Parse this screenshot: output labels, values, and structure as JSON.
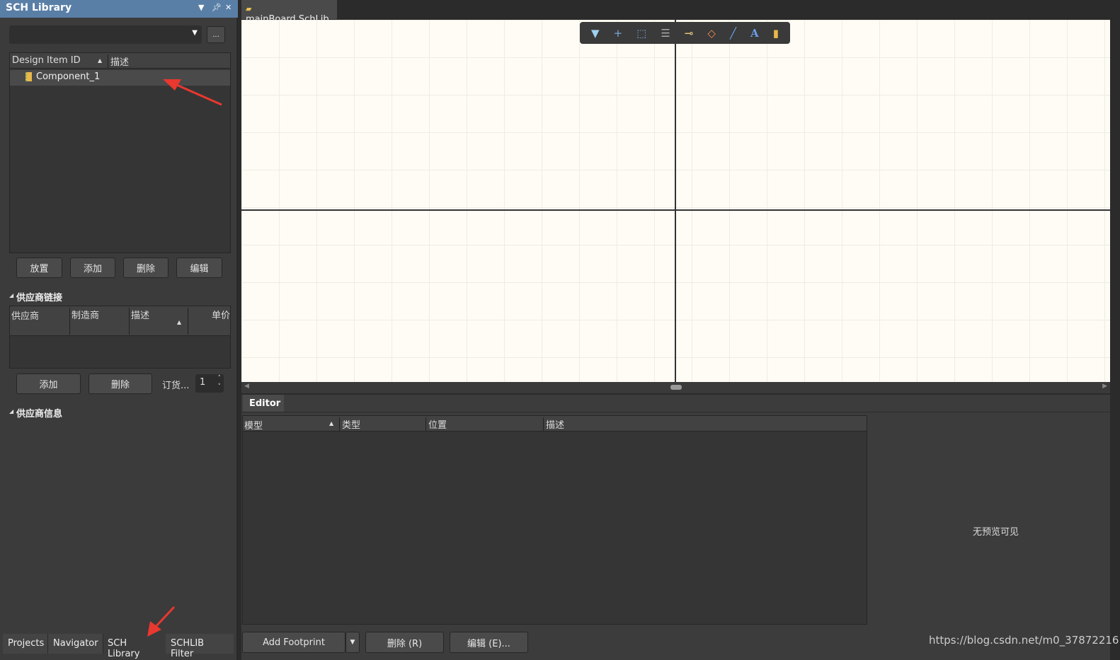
{
  "panel": {
    "title": "SCH Library",
    "dropdown_value": "",
    "more_label": "...",
    "columns": [
      "Design Item ID",
      "描述"
    ],
    "items": [
      {
        "id": "Component_1",
        "desc": ""
      }
    ],
    "buttons": [
      "放置",
      "添加",
      "删除",
      "编辑"
    ]
  },
  "supplier_links": {
    "title": "供应商链接",
    "columns": [
      "供应商",
      "制造商",
      "描述",
      "单价"
    ],
    "buttons": [
      "添加",
      "删除"
    ],
    "order_label": "订货...",
    "order_qty": "1"
  },
  "supplier_info": {
    "title": "供应商信息"
  },
  "bottom_tabs": [
    "Projects",
    "Navigator",
    "SCH Library",
    "SCHLIB Filter"
  ],
  "doc_tab": "mainBoard.SchLib",
  "toolbar": [
    "filter-icon",
    "crosshair-icon",
    "select-rect-icon",
    "align-icon",
    "pin-icon",
    "fill-icon",
    "line-icon",
    "text-icon",
    "component-icon"
  ],
  "editor": {
    "tab": "Editor",
    "columns": [
      "模型",
      "类型",
      "位置",
      "描述"
    ],
    "preview": "无预览可见",
    "buttons": {
      "add": "Add Footprint",
      "delete": "删除 (R)",
      "edit": "编辑 (E)..."
    }
  },
  "watermark": "https://blog.csdn.net/m0_37872216",
  "colors": {
    "title_bar": "#5a7fa7",
    "canvas": "#fffcf5",
    "arrow": "#e8382f"
  }
}
